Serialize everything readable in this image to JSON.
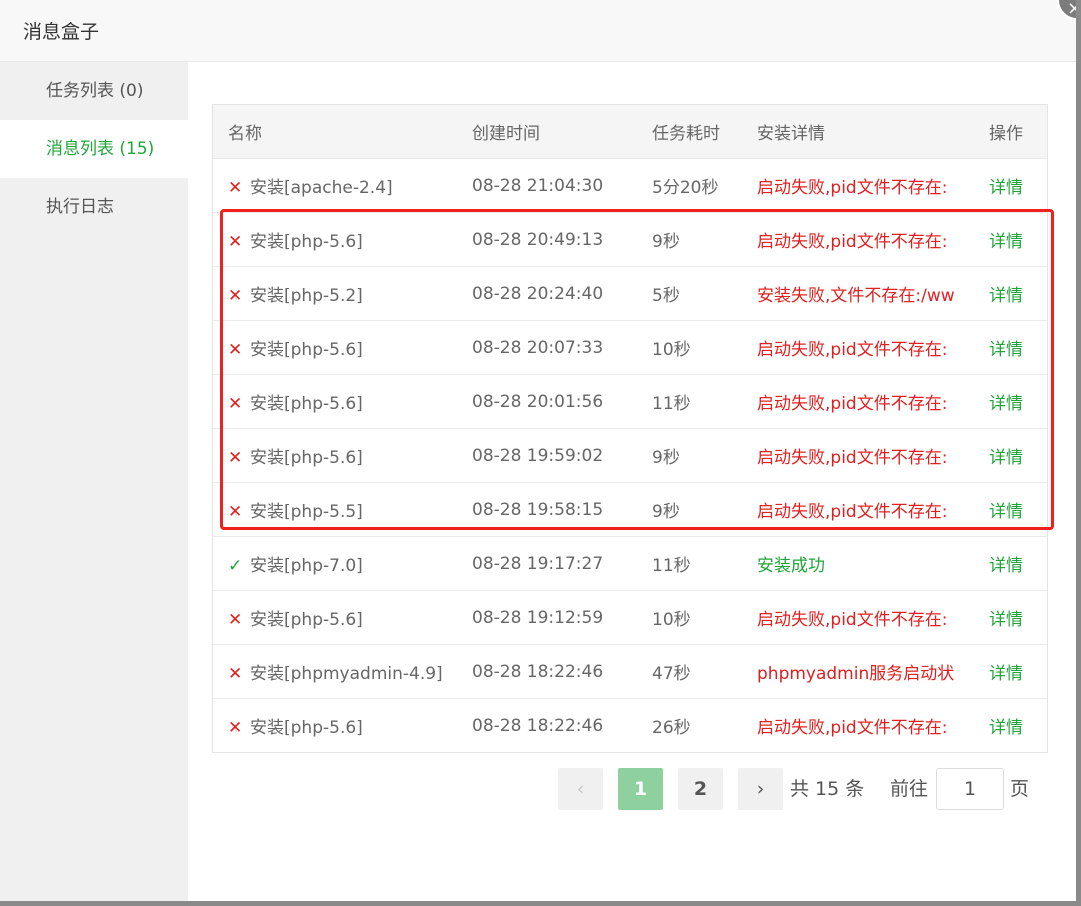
{
  "dialog": {
    "title": "消息盒子",
    "close_icon": "×"
  },
  "sidebar": {
    "items": [
      {
        "label": "任务列表 (0)",
        "active": false
      },
      {
        "label": "消息列表 (15)",
        "active": true
      },
      {
        "label": "执行日志",
        "active": false
      }
    ]
  },
  "table": {
    "headers": [
      "名称",
      "创建时间",
      "任务耗时",
      "安装详情",
      "操作"
    ],
    "rows": [
      {
        "status": "fail",
        "status_icon": "✕",
        "name": "安装[apache-2.4]",
        "time": "08-28 21:04:30",
        "duration": "5分20秒",
        "detail": "启动失败,pid文件不存在:",
        "action": "详情"
      },
      {
        "status": "fail",
        "status_icon": "✕",
        "name": "安装[php-5.6]",
        "time": "08-28 20:49:13",
        "duration": "9秒",
        "detail": "启动失败,pid文件不存在:",
        "action": "详情"
      },
      {
        "status": "fail",
        "status_icon": "✕",
        "name": "安装[php-5.2]",
        "time": "08-28 20:24:40",
        "duration": "5秒",
        "detail": "安装失败,文件不存在:/ww",
        "action": "详情"
      },
      {
        "status": "fail",
        "status_icon": "✕",
        "name": "安装[php-5.6]",
        "time": "08-28 20:07:33",
        "duration": "10秒",
        "detail": "启动失败,pid文件不存在:",
        "action": "详情"
      },
      {
        "status": "fail",
        "status_icon": "✕",
        "name": "安装[php-5.6]",
        "time": "08-28 20:01:56",
        "duration": "11秒",
        "detail": "启动失败,pid文件不存在:",
        "action": "详情"
      },
      {
        "status": "fail",
        "status_icon": "✕",
        "name": "安装[php-5.6]",
        "time": "08-28 19:59:02",
        "duration": "9秒",
        "detail": "启动失败,pid文件不存在:",
        "action": "详情"
      },
      {
        "status": "fail",
        "status_icon": "✕",
        "name": "安装[php-5.5]",
        "time": "08-28 19:58:15",
        "duration": "9秒",
        "detail": "启动失败,pid文件不存在:",
        "action": "详情"
      },
      {
        "status": "ok",
        "status_icon": "✓",
        "name": "安装[php-7.0]",
        "time": "08-28 19:17:27",
        "duration": "11秒",
        "detail": "安装成功",
        "action": "详情"
      },
      {
        "status": "fail",
        "status_icon": "✕",
        "name": "安装[php-5.6]",
        "time": "08-28 19:12:59",
        "duration": "10秒",
        "detail": "启动失败,pid文件不存在:",
        "action": "详情"
      },
      {
        "status": "fail",
        "status_icon": "✕",
        "name": "安装[phpmyadmin-4.9]",
        "time": "08-28 18:22:46",
        "duration": "47秒",
        "detail": "phpmyadmin服务启动状",
        "action": "详情"
      },
      {
        "status": "fail",
        "status_icon": "✕",
        "name": "安装[php-5.6]",
        "time": "08-28 18:22:46",
        "duration": "26秒",
        "detail": "启动失败,pid文件不存在:",
        "action": "详情"
      }
    ]
  },
  "pagination": {
    "prev_icon": "‹",
    "next_icon": "›",
    "pages": [
      "1",
      "2"
    ],
    "current_page": "1",
    "total_text": "共 15 条",
    "goto_label": "前往",
    "goto_value": "1",
    "page_suffix": "页"
  },
  "colors": {
    "accent": "#20a53a",
    "error": "#e02020",
    "highlight_border": "#f02020",
    "active_page": "#8fd19e"
  }
}
